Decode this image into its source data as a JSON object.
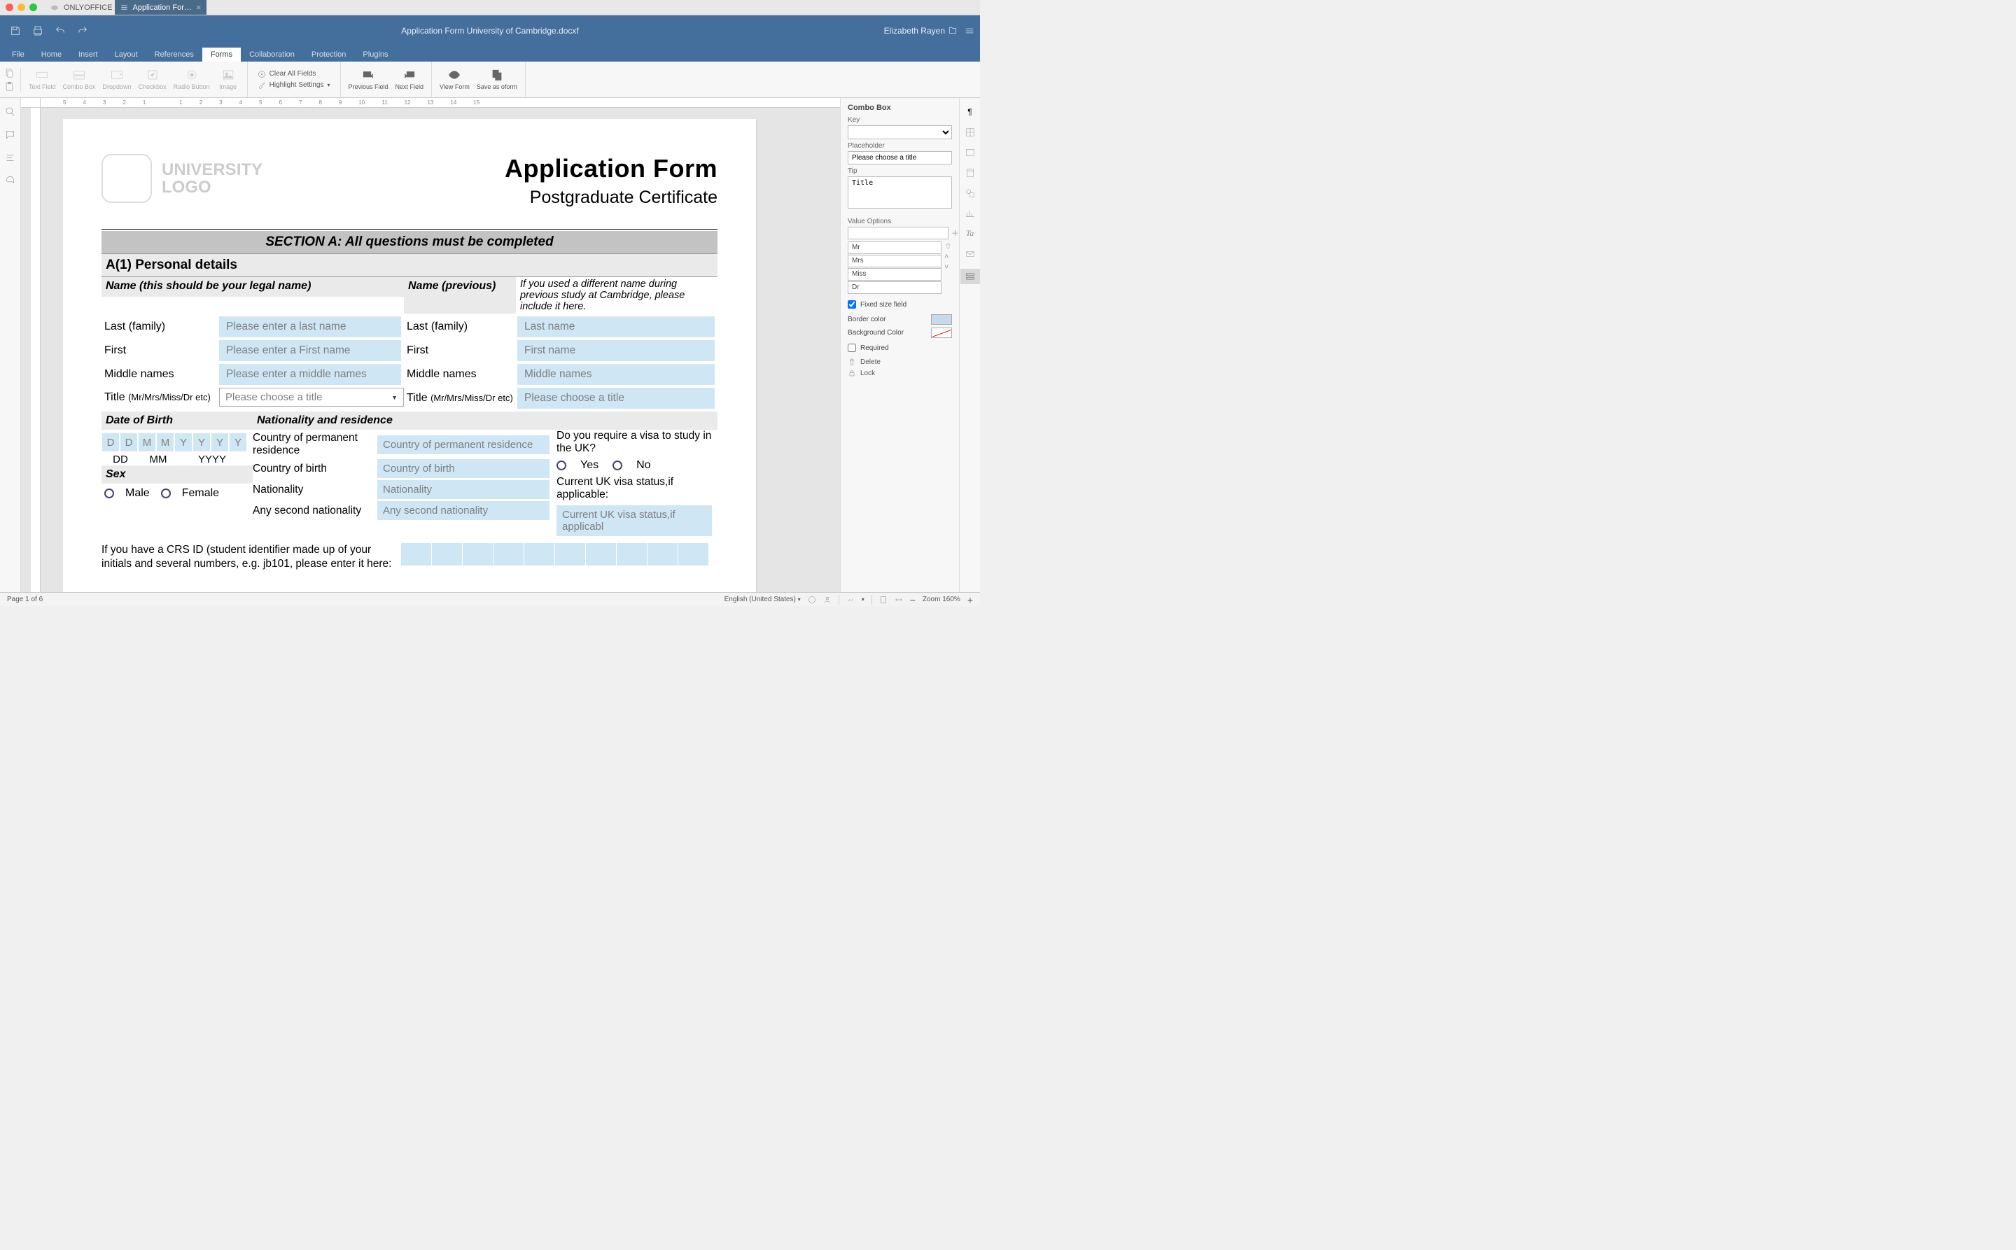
{
  "app": {
    "name": "ONLYOFFICE",
    "doc_tab": "Application For…"
  },
  "header": {
    "doc_title": "Application Form University of Cambridge.docxf",
    "user": "Elizabeth Rayen"
  },
  "menu": {
    "tabs": [
      "File",
      "Home",
      "Insert",
      "Layout",
      "References",
      "Forms",
      "Collaboration",
      "Protection",
      "Plugins"
    ],
    "active": "Forms"
  },
  "ribbon": {
    "text_field": "Text Field",
    "combo_box": "Combo Box",
    "dropdown": "Dropdown",
    "checkbox": "Checkbox",
    "radio": "Radio Button",
    "image": "Image",
    "clear_all": "Clear All Fields",
    "highlight": "Highlight Settings",
    "prev": "Previous Field",
    "next": "Next Field",
    "view_form": "View Form",
    "save_oform": "Save as oform"
  },
  "doc": {
    "logo_l1": "UNIVERSITY",
    "logo_l2": "LOGO",
    "title": "Application Form",
    "subtitle": "Postgraduate Certificate",
    "section_a": "SECTION A: All questions must be completed",
    "a1": "A(1) Personal details",
    "name_h": "Name (this should be your legal name)",
    "name_prev_h": "Name (previous)",
    "name_prev_note": "If you used a different name during previous study at Cambridge, please include it here.",
    "last": "Last (family)",
    "first": "First",
    "middle": "Middle names",
    "title_lbl": "Title ",
    "title_paren": "(Mr/Mrs/Miss/Dr etc)",
    "ph_last": "Please enter a last name",
    "ph_first": "Please enter a First name",
    "ph_middle": "Please enter a middle names",
    "ph_title": "Please choose a title",
    "prev_ph_last": "Last name",
    "prev_ph_first": "First name",
    "prev_ph_middle": "Middle names",
    "prev_ph_title": "Please choose a title",
    "dob_h": "Date of Birth",
    "nat_h": "Nationality and residence",
    "dob_letters": [
      "D",
      "D",
      "M",
      "M",
      "Y",
      "Y",
      "Y",
      "Y"
    ],
    "dd": "DD",
    "mm": "MM",
    "yyyy": "YYYY",
    "sex_h": "Sex",
    "male": "Male",
    "female": "Female",
    "cpr": "Country of permanent residence",
    "cpr_ph": "Country of permanent residence",
    "cob": "Country of birth",
    "cob_ph": "Country of birth",
    "nationality": "Nationality",
    "nationality_ph": "Nationality",
    "second_nat": "Any second nationality",
    "second_nat_ph": "Any second nationality",
    "visa_q": "Do you require a visa to study in the UK?",
    "yes": "Yes",
    "no": "No",
    "visa_status": "Current UK visa status,if applicable:",
    "visa_status_ph": "Current UK visa status,if applicabl",
    "crs": "If you have a CRS ID (student identifier made up of your initials and several numbers, e.g. jb101, please enter it here:"
  },
  "panel": {
    "title": "Combo Box",
    "key": "Key",
    "placeholder": "Placeholder",
    "placeholder_val": "Please choose a title",
    "tip": "Tip",
    "tip_val": "Title",
    "value_options": "Value Options",
    "options": [
      "Mr",
      "Mrs",
      "Miss",
      "Dr"
    ],
    "fixed": "Fixed size field",
    "border": "Border color",
    "bg": "Background Color",
    "required": "Required",
    "delete": "Delete",
    "lock": "Lock"
  },
  "status": {
    "page": "Page 1 of 6",
    "lang": "English (United States)",
    "zoom": "Zoom 160%"
  }
}
